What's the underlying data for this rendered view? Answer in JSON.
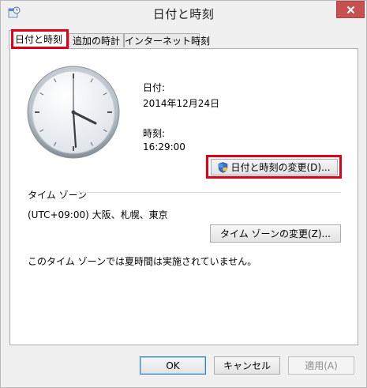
{
  "window": {
    "title": "日付と時刻",
    "close_icon": "close-icon"
  },
  "tabs": [
    {
      "label": "日付と時刻",
      "active": true
    },
    {
      "label": "追加の時計",
      "active": false
    },
    {
      "label": "インターネット時刻",
      "active": false
    }
  ],
  "datetime": {
    "date_label": "日付:",
    "date_value": "2014年12月24日",
    "time_label": "時刻:",
    "time_value": "16:29:00",
    "change_button": "日付と時刻の変更(D)..."
  },
  "timezone": {
    "group_label": "タイム ゾーン",
    "value": "(UTC+09:00) 大阪、札幌、東京",
    "change_button": "タイム ゾーンの変更(Z)...",
    "dst_note": "このタイム ゾーンでは夏時間は実施されていません。"
  },
  "footer": {
    "ok": "OK",
    "cancel": "キャンセル",
    "apply": "適用(A)"
  },
  "colors": {
    "highlight": "#e0001a",
    "close_button": "#c75050"
  }
}
